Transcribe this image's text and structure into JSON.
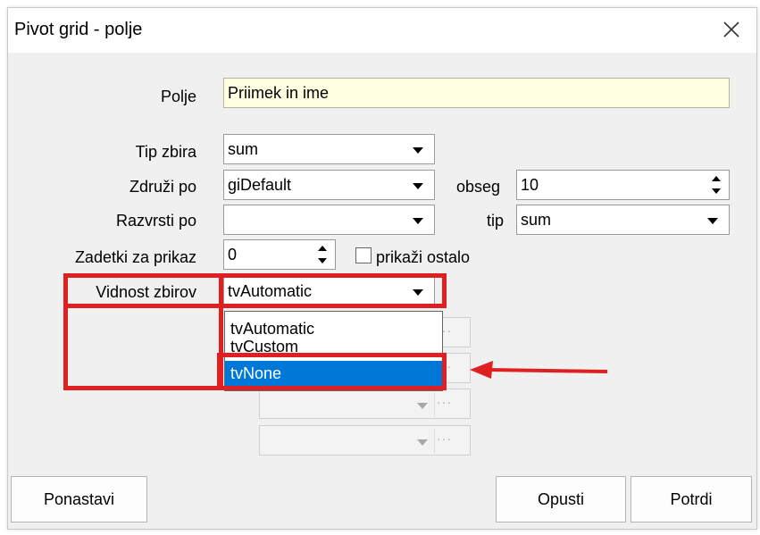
{
  "window": {
    "title": "Pivot grid - polje"
  },
  "fields": {
    "polje": {
      "label": "Polje",
      "value": "Priimek in ime"
    },
    "tip_zbira": {
      "label": "Tip zbira",
      "value": "sum"
    },
    "zdruzi_po": {
      "label": "Združi po",
      "value": "giDefault"
    },
    "obseg": {
      "label": "obseg",
      "value": "10"
    },
    "razvrsti_po": {
      "label": "Razvrsti po",
      "value": ""
    },
    "tip": {
      "label": "tip",
      "value": "sum"
    },
    "zadetki": {
      "label": "Zadetki za prikaz",
      "value": "0"
    },
    "prikazi_ostalo": {
      "label": "prikaži ostalo",
      "checked": false
    },
    "vidnost": {
      "label": "Vidnost zbirov",
      "value": "tvAutomatic"
    }
  },
  "dropdown": {
    "options": [
      "tvAutomatic",
      "tvCustom",
      "tvNone"
    ],
    "highlighted": "tvNone"
  },
  "buttons": {
    "reset": "Ponastavi",
    "cancel": "Opusti",
    "confirm": "Potrdi"
  },
  "icons": {
    "close": "close-icon",
    "ellipsis": "···"
  },
  "colors": {
    "highlight_annotation": "#e02020",
    "selection": "#0078d7",
    "field_yellow": "#ffffe1"
  }
}
